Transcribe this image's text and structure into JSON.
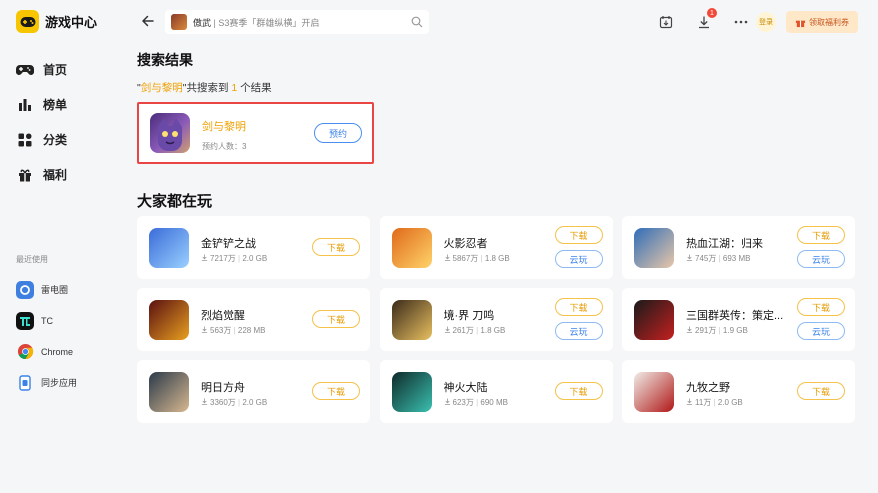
{
  "app": {
    "title": "游戏中心"
  },
  "nav": [
    {
      "label": "首页",
      "icon": "gamepad-icon"
    },
    {
      "label": "榜单",
      "icon": "bar-chart-icon"
    },
    {
      "label": "分类",
      "icon": "grid-icon"
    },
    {
      "label": "福利",
      "icon": "gift-icon"
    }
  ],
  "recent": {
    "title": "最近使用",
    "items": [
      {
        "label": "雷电圈",
        "icon": "ring-app-icon",
        "color": "#3f7fe0"
      },
      {
        "label": "TC",
        "icon": "tc-app-icon",
        "color": "#111111"
      },
      {
        "label": "Chrome",
        "icon": "chrome-icon",
        "color": "#ffffff"
      },
      {
        "label": "同步应用",
        "icon": "sync-app-icon",
        "color": "#ffffff"
      }
    ]
  },
  "search": {
    "game": "傲武",
    "sub": "S3赛季「群雄纵横」开启"
  },
  "header": {
    "badge": "1",
    "login": "登录",
    "welfare": "领取福利券"
  },
  "result": {
    "section_title": "搜索结果",
    "summary_q_open": "\"",
    "summary_query": "剑与黎明",
    "summary_mid": "\"共搜索到",
    "summary_count": "1",
    "summary_end": "个结果",
    "name": "剑与黎明",
    "meta": "预约人数：3",
    "button": "预约"
  },
  "popular": {
    "title": "大家都在玩",
    "download_label": "下载",
    "cloud_label": "云玩",
    "games": [
      {
        "name": "金铲铲之战",
        "downloads": "7217万",
        "size": "2.0 GB",
        "cloud": false,
        "c1": "#3a6cd8",
        "c2": "#9ad0ff"
      },
      {
        "name": "火影忍者",
        "downloads": "5867万",
        "size": "1.8 GB",
        "cloud": true,
        "c1": "#e06a1a",
        "c2": "#ffd36a"
      },
      {
        "name": "热血江湖：归来",
        "downloads": "745万",
        "size": "693 MB",
        "cloud": true,
        "c1": "#2f6db8",
        "c2": "#e8c7a8"
      },
      {
        "name": "烈焰觉醒",
        "downloads": "563万",
        "size": "228 MB",
        "cloud": false,
        "c1": "#5a1010",
        "c2": "#e8a020"
      },
      {
        "name": "境·界 刀鸣",
        "downloads": "261万",
        "size": "1.8 GB",
        "cloud": true,
        "c1": "#3a2a1a",
        "c2": "#e8c060"
      },
      {
        "name": "三国群英传：策定...",
        "downloads": "291万",
        "size": "1.9 GB",
        "cloud": true,
        "c1": "#1a1a1a",
        "c2": "#c42020"
      },
      {
        "name": "明日方舟",
        "downloads": "3360万",
        "size": "2.0 GB",
        "cloud": false,
        "c1": "#2a3a4a",
        "c2": "#d8b890"
      },
      {
        "name": "神火大陆",
        "downloads": "623万",
        "size": "690 MB",
        "cloud": false,
        "c1": "#0f2a2a",
        "c2": "#3ac0b0"
      },
      {
        "name": "九牧之野",
        "downloads": "11万",
        "size": "2.0 GB",
        "cloud": false,
        "c1": "#f0ece6",
        "c2": "#b01818"
      }
    ]
  }
}
